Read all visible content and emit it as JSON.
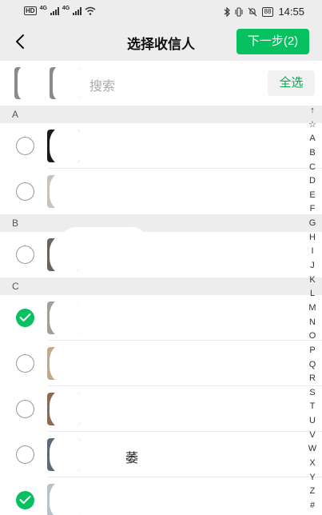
{
  "status_bar": {
    "hd": "HD",
    "net_1": "4G",
    "net_2": "4G",
    "battery": "88",
    "time": "14:55"
  },
  "nav": {
    "title": "选择收信人",
    "next_label": "下一步(2)"
  },
  "search": {
    "placeholder": "搜索",
    "select_all_label": "全选"
  },
  "sections": [
    {
      "letter": "A",
      "contacts": [
        {
          "checked": false
        },
        {
          "checked": false
        }
      ]
    },
    {
      "letter": "B",
      "contacts": [
        {
          "checked": false
        }
      ]
    },
    {
      "letter": "C",
      "contacts": [
        {
          "checked": true
        },
        {
          "checked": false
        },
        {
          "checked": false
        },
        {
          "checked": false,
          "name_fragment": "萎"
        },
        {
          "checked": true
        }
      ]
    }
  ],
  "index_letters": [
    "↑",
    "☆",
    "A",
    "B",
    "C",
    "D",
    "E",
    "F",
    "G",
    "H",
    "I",
    "J",
    "K",
    "L",
    "M",
    "N",
    "O",
    "P",
    "Q",
    "R",
    "S",
    "T",
    "U",
    "V",
    "W",
    "X",
    "Y",
    "Z",
    "#"
  ],
  "colors": {
    "accent": "#07c160",
    "header_bg": "#ededed"
  }
}
